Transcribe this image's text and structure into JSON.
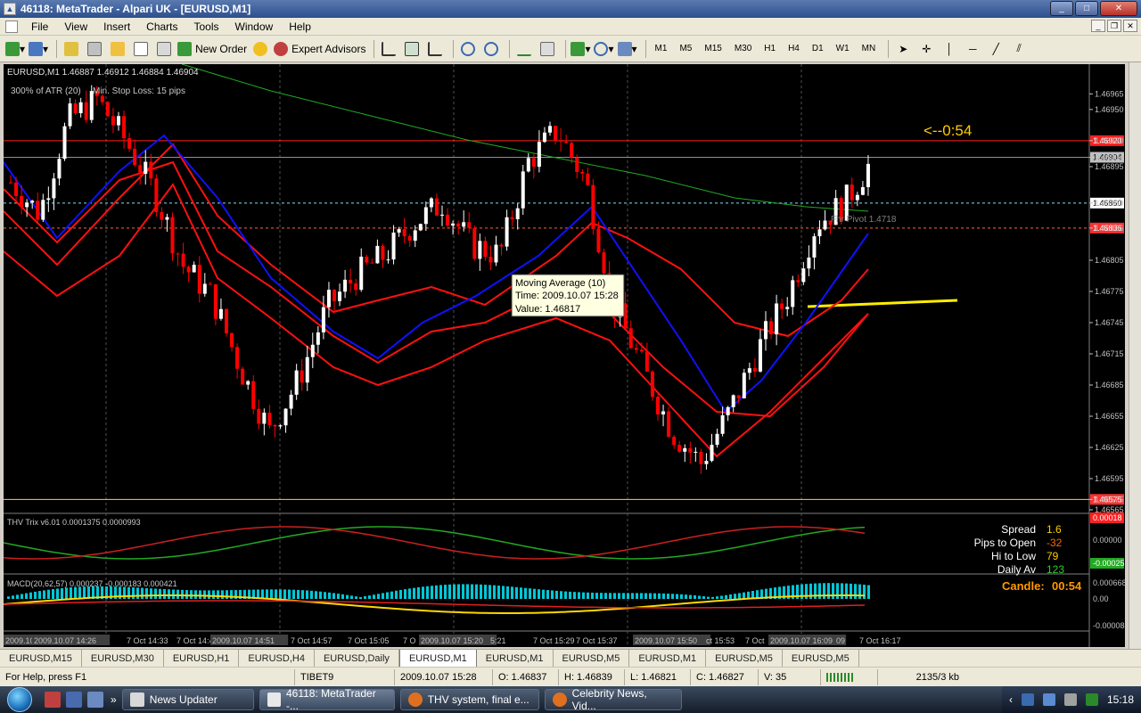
{
  "window": {
    "title": "46118: MetaTrader - Alpari UK - [EURUSD,M1]"
  },
  "menu": [
    "File",
    "View",
    "Insert",
    "Charts",
    "Tools",
    "Window",
    "Help"
  ],
  "toolbar": {
    "new_order": "New Order",
    "expert_advisors": "Expert Advisors",
    "timeframes": [
      "M1",
      "M5",
      "M15",
      "M30",
      "H1",
      "H4",
      "D1",
      "W1",
      "MN"
    ]
  },
  "chart": {
    "header": "EURUSD,M1  1.46887 1.46912 1.46884 1.46904",
    "atr_label": "300% of ATR (20)",
    "stop_loss_label": "Min. Stop Loss:  15 pips",
    "countdown": "<--0:54",
    "pivot_label": "Fhr Pivot 1.4718",
    "tooltip": {
      "line1": "Moving Average (10)",
      "line2": "Time: 2009.10.07 15:28",
      "line3": "Value: 1.46817"
    },
    "price_levels": [
      "1.46965",
      "1.46950",
      "1.46920",
      "1.46904",
      "1.46895",
      "1.46860",
      "1.46836",
      "1.46805",
      "1.46775",
      "1.46745",
      "1.46715",
      "1.46685",
      "1.46655",
      "1.46625",
      "1.46595",
      "1.46575",
      "1.46565"
    ],
    "highlighted_levels": {
      "red_top": "1.46920",
      "current": "1.46904",
      "cyan": "1.46860",
      "red_dashed": "1.46836",
      "yellow": "1.46575"
    },
    "colors": {
      "bull": "#ffffff",
      "bear": "#ff0000",
      "ma_blue": "#1010ff",
      "envelope_red": "#ff1010",
      "ma_green": "#22aa22",
      "background": "#000000",
      "grid": "#505050",
      "yellow": "#ffee00"
    }
  },
  "thv_panel": {
    "header": "THV Trix v6.01  0.0001375  0.0000993",
    "levels": [
      "0.00018",
      "0.00000",
      "-0.00025"
    ],
    "info": [
      {
        "label": "Spread",
        "value": "1.6",
        "color": "#ffcc00"
      },
      {
        "label": "Pips to Open",
        "value": "-32",
        "color": "#ff6600"
      },
      {
        "label": "Hi to Low",
        "value": "79",
        "color": "#ffcc00"
      },
      {
        "label": "Daily Av",
        "value": "123",
        "color": "#33cc33"
      }
    ]
  },
  "macd_panel": {
    "header": "MACD(20,62,57)  0.000237  -0.000183  0.000421",
    "candle_label": "Candle:",
    "candle_value": "00:54",
    "levels": [
      "0.000668",
      "0.00",
      "-0.000088"
    ]
  },
  "time_axis": [
    "2009.10.",
    "2009.10.07 14:26",
    "7 Oct 14:33",
    "7 Oct 14:4",
    "2009.10.07 14:51",
    "7 Oct 14:57",
    "7 Oct 15:05",
    "7 O",
    "2009.10.07 15:20",
    "5:21",
    "7 Oct 15:29",
    "7 Oct 15:37",
    "2009.10.07 15:50",
    "ct 15:53",
    "7 Oct",
    "2009.10.07 16:09",
    "09",
    "7 Oct 16:17"
  ],
  "tabs": [
    "EURUSD,M15",
    "EURUSD,M30",
    "EURUSD,H1",
    "EURUSD,H4",
    "EURUSD,Daily",
    "EURUSD,M1",
    "EURUSD,M1",
    "EURUSD,M5",
    "EURUSD,M1",
    "EURUSD,M5",
    "EURUSD,M5"
  ],
  "active_tab_index": 5,
  "status": {
    "help": "For Help, press F1",
    "time": "2009.10.07 15:28",
    "profile": "TIBET9",
    "open": "O: 1.46837",
    "high": "H: 1.46839",
    "low": "L: 1.46821",
    "close": "C: 1.46827",
    "volume": "V: 35",
    "traffic": "2135/3 kb"
  },
  "taskbar": {
    "items": [
      "News Updater",
      "46118: MetaTrader -...",
      "THV system, final e...",
      "Celebrity News, Vid..."
    ],
    "active_index": 1,
    "clock": "15:18"
  }
}
